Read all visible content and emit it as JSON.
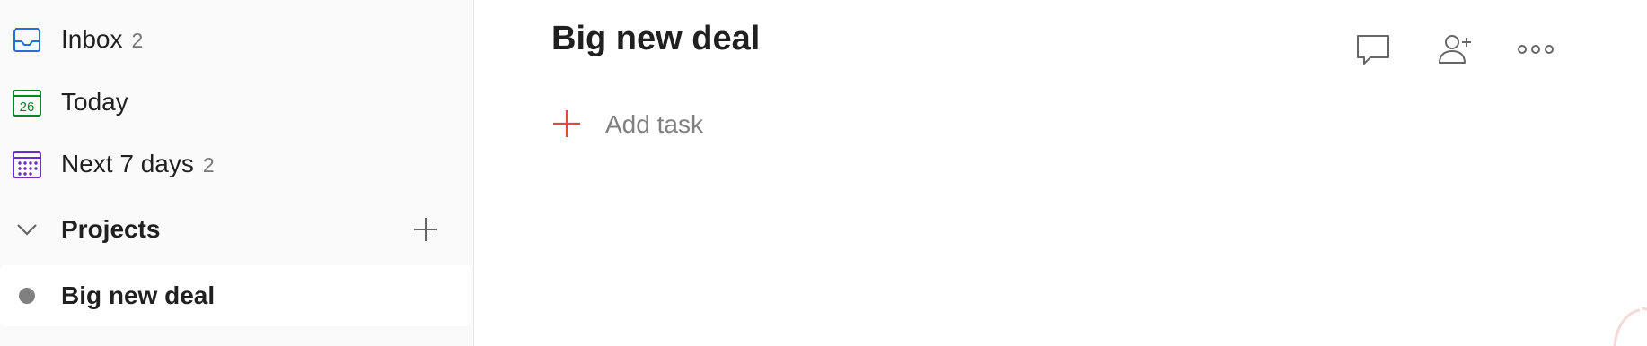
{
  "sidebar": {
    "inbox": {
      "label": "Inbox",
      "count": "2",
      "icon": "inbox-icon",
      "color": "#246fe0"
    },
    "today": {
      "label": "Today",
      "day": "26",
      "icon": "calendar-today-icon",
      "color": "#058527"
    },
    "next7": {
      "label": "Next 7 days",
      "count": "2",
      "icon": "calendar-week-icon",
      "color": "#692fc2"
    },
    "projects": {
      "title": "Projects"
    },
    "project_items": [
      {
        "name": "Big new deal",
        "color": "#808080",
        "selected": true
      }
    ]
  },
  "main": {
    "title": "Big new deal",
    "add_task_label": "Add task",
    "accent": "#db4c3f",
    "toolbar": [
      "comment-icon",
      "share-icon",
      "more-icon"
    ]
  }
}
